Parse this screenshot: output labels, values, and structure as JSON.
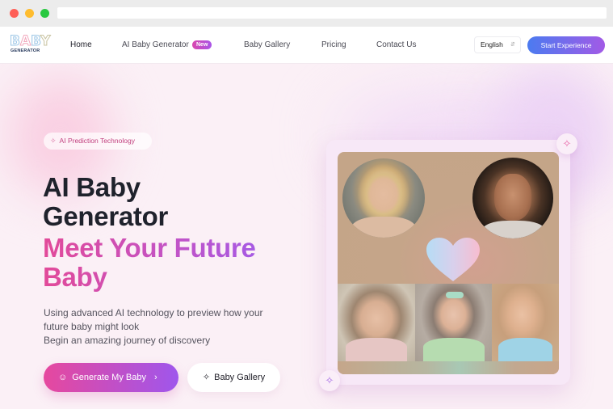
{
  "browser": {
    "window_controls": [
      "close",
      "minimize",
      "maximize"
    ]
  },
  "header": {
    "logo": {
      "letters": [
        "B",
        "A",
        "B",
        "Y"
      ],
      "subtitle": "GENERATOR"
    },
    "nav": [
      {
        "label": "Home",
        "active": true
      },
      {
        "label": "AI Baby Generator",
        "badge": "New"
      },
      {
        "label": "Baby Gallery"
      },
      {
        "label": "Pricing"
      },
      {
        "label": "Contact Us"
      }
    ],
    "language": {
      "selected": "English",
      "icon": "updown-chevron-icon"
    },
    "cta_label": "Start Experience"
  },
  "hero": {
    "tag": {
      "icon": "sparkle-icon",
      "label": "AI Prediction Technology"
    },
    "title_line1": "AI Baby",
    "title_line2": "Generator",
    "highlight_line1": "Meet Your Future",
    "highlight_line2": "Baby",
    "description_line1": "Using advanced AI technology to preview how your",
    "description_line2": "future baby might look",
    "description_line3": "Begin an amazing journey of discovery",
    "primary_button": {
      "icon": "smile-icon",
      "label": "Generate My Baby",
      "arrow": "›"
    },
    "secondary_button": {
      "icon": "sparkle-icon",
      "label": "Baby Gallery"
    }
  },
  "showcase": {
    "parents": [
      "mother-portrait",
      "father-portrait"
    ],
    "center_icon": "heart-icon",
    "babies": [
      "baby-portrait-1",
      "baby-portrait-2",
      "baby-portrait-3"
    ],
    "badge_icons": [
      "sparkle-icon",
      "sparkle-icon"
    ]
  },
  "colors": {
    "accent_pink": "#e24a99",
    "accent_purple": "#9a5df0",
    "cta_blue": "#4b7bf0",
    "background": "#fbf0f6",
    "title_dark": "#1f222c"
  }
}
